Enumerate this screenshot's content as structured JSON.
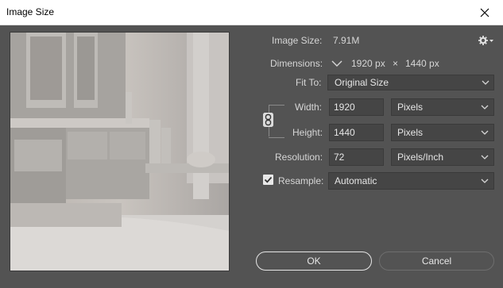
{
  "window": {
    "title": "Image Size"
  },
  "info": {
    "image_size_label": "Image Size:",
    "image_size_value": "7.91M",
    "dimensions_label": "Dimensions:",
    "dim_width": "1920 px",
    "dim_x": "×",
    "dim_height": "1440 px"
  },
  "fit_to": {
    "label": "Fit To:",
    "value": "Original Size"
  },
  "width": {
    "label": "Width:",
    "value": "1920",
    "unit": "Pixels"
  },
  "height": {
    "label": "Height:",
    "value": "1440",
    "unit": "Pixels"
  },
  "resolution": {
    "label": "Resolution:",
    "value": "72",
    "unit": "Pixels/Inch"
  },
  "resample": {
    "label": "Resample:",
    "checked": true,
    "value": "Automatic"
  },
  "buttons": {
    "ok": "OK",
    "cancel": "Cancel"
  },
  "icons": {
    "close": "close-icon",
    "gear": "gear-icon",
    "chain": "chain-link-icon",
    "chevron": "chevron-down-icon",
    "check": "checkmark-icon"
  },
  "colors": {
    "dialog_bg": "#535353",
    "field_bg": "#454545",
    "text": "#d6d6d6"
  }
}
